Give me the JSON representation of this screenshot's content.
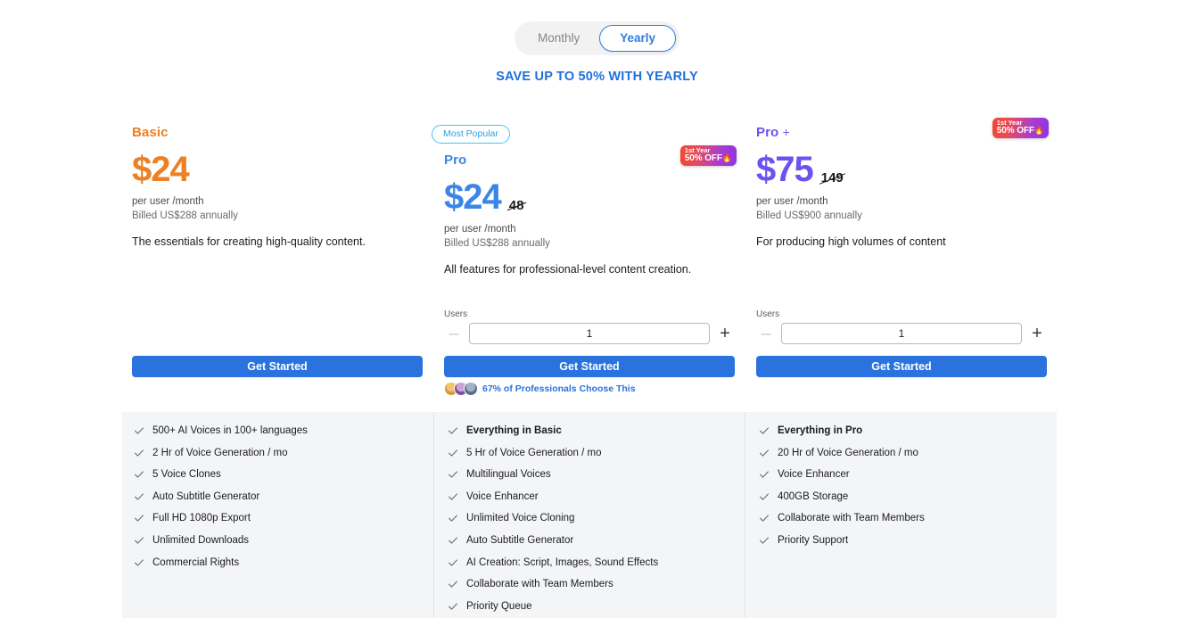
{
  "billing_toggle": {
    "options": [
      {
        "label": "Monthly",
        "active": false
      },
      {
        "label": "Yearly",
        "active": true
      }
    ],
    "save_note": "SAVE UP TO 50% WITH YEARLY"
  },
  "colors": {
    "basic_accent": "#ec8023",
    "pro_accent": "#3b85e8",
    "proplus_accent": "#6c52f0",
    "cta_blue": "#2a72dd",
    "link_blue": "#1f6fde",
    "panel_bg": "#f4f5f7",
    "popular_border": "#45c6f0",
    "badge_gradient_from": "#f0472f",
    "badge_gradient_to": "#8e35e0"
  },
  "plans": [
    {
      "id": "basic",
      "name": "Basic",
      "name_suffix": "",
      "popular_badge": "",
      "discount_badge": {
        "line1": "",
        "line2": "",
        "fire": ""
      },
      "price": "$24",
      "old_price": "",
      "per": "per user /month",
      "billed": "Billed US$288 annually",
      "description": "The essentials for creating high-quality content.",
      "users_label": "",
      "users_value": "",
      "minus_label": "",
      "plus_label": "",
      "cta_label": "Get Started",
      "social_proof": "",
      "features": [
        {
          "text": "500+ AI Voices in 100+ languages",
          "bold": false
        },
        {
          "text": "2 Hr of Voice Generation / mo",
          "bold": false
        },
        {
          "text": "5 Voice Clones",
          "bold": false
        },
        {
          "text": "Auto Subtitle Generator",
          "bold": false
        },
        {
          "text": "Full HD 1080p Export",
          "bold": false
        },
        {
          "text": "Unlimited Downloads",
          "bold": false
        },
        {
          "text": "Commercial Rights",
          "bold": false
        }
      ]
    },
    {
      "id": "pro",
      "name": "Pro",
      "name_suffix": "",
      "popular_badge": "Most Popular",
      "discount_badge": {
        "line1": "1st Year",
        "line2": "50% OFF",
        "fire": "🔥"
      },
      "price": "$24",
      "old_price": "48",
      "per": "per user /month",
      "billed": "Billed US$288 annually",
      "description": "All features for professional-level content creation.",
      "users_label": "Users",
      "users_value": "1",
      "minus_label": "–",
      "plus_label": "+",
      "cta_label": "Get Started",
      "social_proof": "67% of Professionals Choose This",
      "features": [
        {
          "text": "Everything in Basic",
          "bold": true
        },
        {
          "text": "5 Hr of Voice Generation / mo",
          "bold": false
        },
        {
          "text": "Multilingual Voices",
          "bold": false
        },
        {
          "text": "Voice Enhancer",
          "bold": false
        },
        {
          "text": "Unlimited Voice Cloning",
          "bold": false
        },
        {
          "text": "Auto Subtitle Generator",
          "bold": false
        },
        {
          "text": "AI Creation: Script, Images, Sound Effects",
          "bold": false
        },
        {
          "text": "Collaborate with Team Members",
          "bold": false
        },
        {
          "text": "Priority Queue",
          "bold": false
        }
      ]
    },
    {
      "id": "proplus",
      "name": "Pro",
      "name_suffix": "+",
      "popular_badge": "",
      "discount_badge": {
        "line1": "1st Year",
        "line2": "50% OFF",
        "fire": "🔥"
      },
      "price": "$75",
      "old_price": "149",
      "per": "per user /month",
      "billed": "Billed US$900 annually",
      "description": "For producing high volumes of content",
      "users_label": "Users",
      "users_value": "1",
      "minus_label": "–",
      "plus_label": "+",
      "cta_label": "Get Started",
      "social_proof": "",
      "features": [
        {
          "text": "Everything in Pro",
          "bold": true
        },
        {
          "text": "20 Hr of Voice Generation / mo",
          "bold": false
        },
        {
          "text": "Voice Enhancer",
          "bold": false
        },
        {
          "text": "400GB Storage",
          "bold": false
        },
        {
          "text": "Collaborate with Team Members",
          "bold": false
        },
        {
          "text": "Priority Support",
          "bold": false
        }
      ]
    }
  ]
}
